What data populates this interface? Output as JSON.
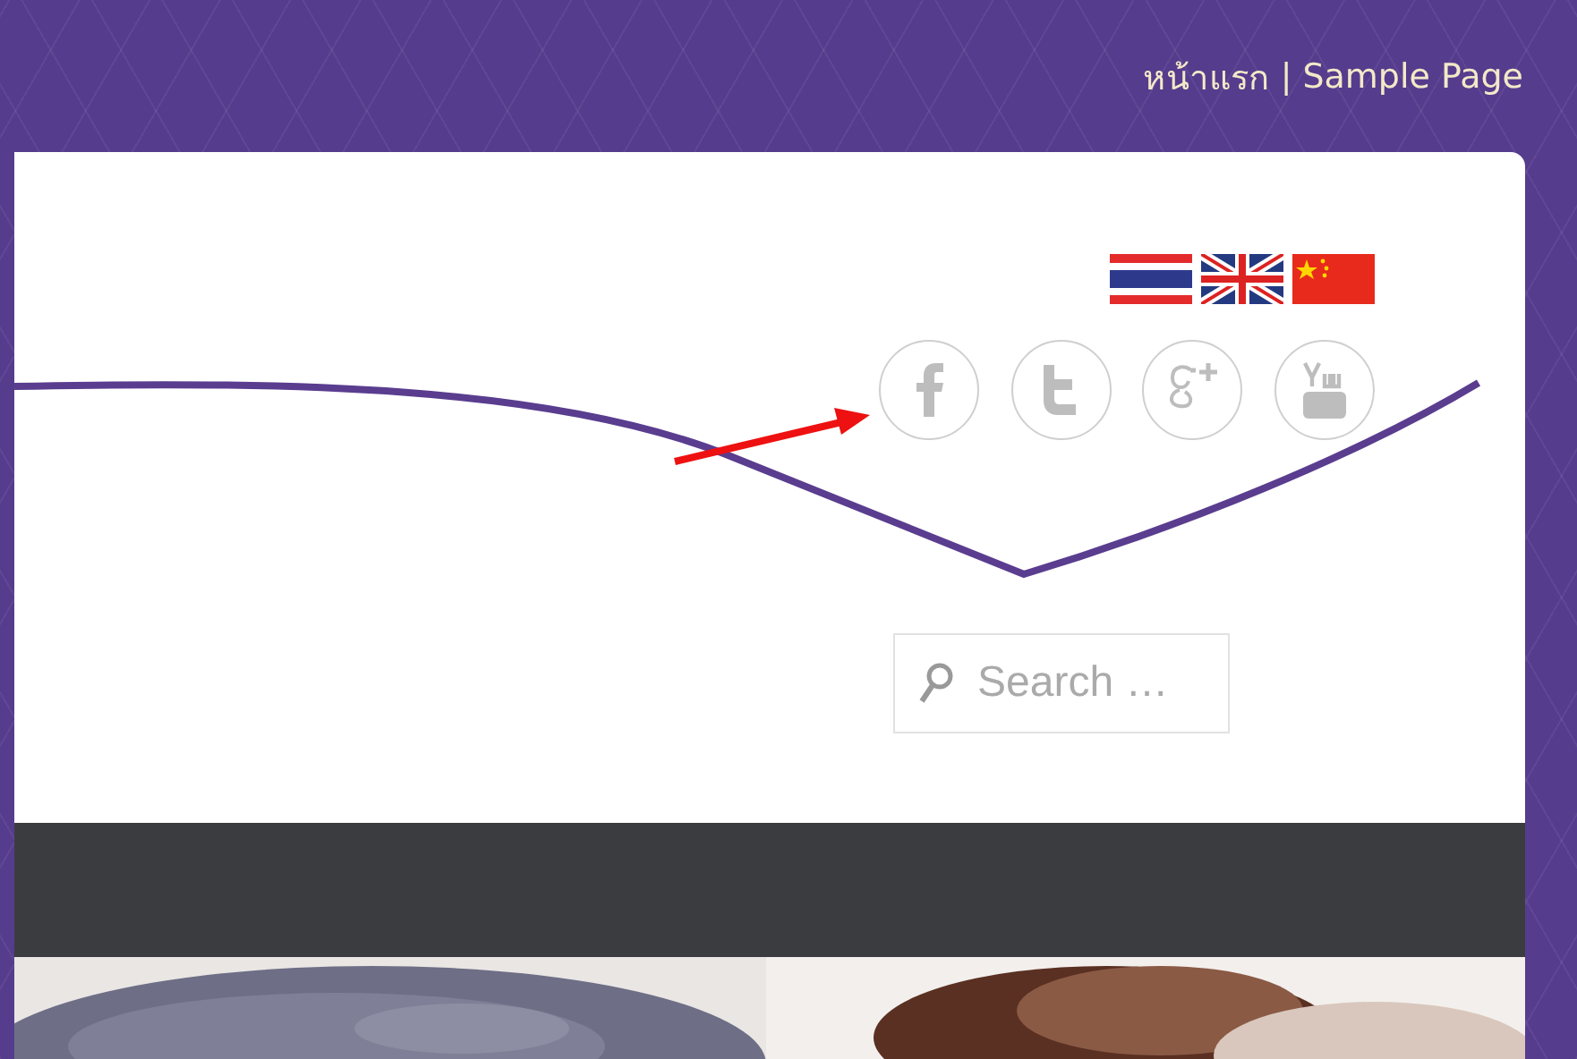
{
  "top_nav": {
    "items": [
      {
        "label": "หน้าแรก"
      },
      {
        "label": "Sample Page"
      }
    ],
    "separator": "|"
  },
  "languages": [
    {
      "kind": "thai"
    },
    {
      "kind": "uk"
    },
    {
      "kind": "china"
    }
  ],
  "social": [
    {
      "kind": "facebook"
    },
    {
      "kind": "twitter"
    },
    {
      "kind": "googleplus"
    },
    {
      "kind": "youtube"
    }
  ],
  "search": {
    "placeholder": "Search …"
  }
}
